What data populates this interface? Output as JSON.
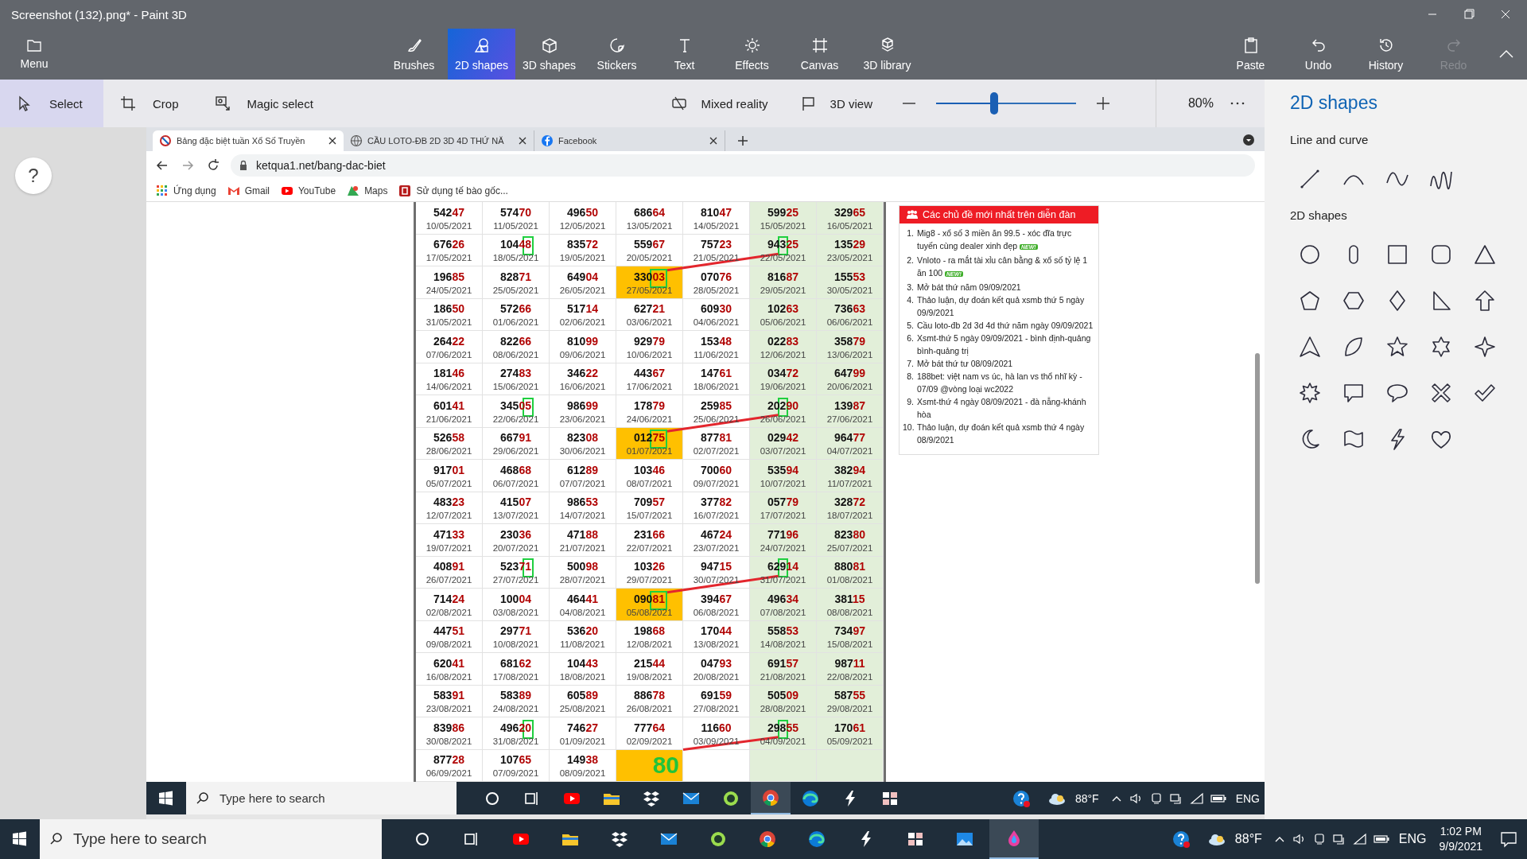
{
  "window": {
    "title": "Screenshot (132).png* - Paint 3D"
  },
  "menu": {
    "label": "Menu"
  },
  "tabs": [
    {
      "label": "Brushes",
      "selected": false
    },
    {
      "label": "2D shapes",
      "selected": true
    },
    {
      "label": "3D shapes",
      "selected": false
    },
    {
      "label": "Stickers",
      "selected": false
    },
    {
      "label": "Text",
      "selected": false
    },
    {
      "label": "Effects",
      "selected": false
    },
    {
      "label": "Canvas",
      "selected": false
    },
    {
      "label": "3D library",
      "selected": false
    }
  ],
  "actions": [
    {
      "label": "Paste",
      "disabled": false
    },
    {
      "label": "Undo",
      "disabled": false
    },
    {
      "label": "History",
      "disabled": false
    },
    {
      "label": "Redo",
      "disabled": true
    }
  ],
  "tools": [
    {
      "label": "Select",
      "selected": true
    },
    {
      "label": "Crop",
      "selected": false
    },
    {
      "label": "Magic select",
      "selected": false
    }
  ],
  "view_buttons": [
    {
      "label": "Mixed reality"
    },
    {
      "label": "3D view"
    }
  ],
  "zoom": {
    "level": 0.39,
    "reading": "80%"
  },
  "help": {
    "label": "?"
  },
  "panel": {
    "title": "2D shapes",
    "sections": [
      {
        "heading": "Line and curve",
        "kind": "lines"
      },
      {
        "heading": "2D shapes",
        "kind": "shapes"
      }
    ]
  },
  "browser": {
    "tabs": [
      {
        "title": "Bảng đặc biệt tuần Xổ Số Truyền",
        "selected": true
      },
      {
        "title": "CẦU LOTO-ĐB 2D 3D 4D THỨ NĂ",
        "selected": false
      },
      {
        "title": "Facebook",
        "selected": false
      }
    ],
    "address": "ketqua1.net/bang-dac-biet",
    "bookmarks": [
      {
        "label": "Ứng dụng"
      },
      {
        "label": "Gmail"
      },
      {
        "label": "YouTube"
      },
      {
        "label": "Maps"
      },
      {
        "label": "Sử dụng tế bào gốc..."
      }
    ]
  },
  "table": {
    "columns": [
      {
        "shaded": false
      },
      {
        "shaded": false
      },
      {
        "shaded": false
      },
      {
        "shaded": false
      },
      {
        "shaded": false
      },
      {
        "shaded": true
      },
      {
        "shaded": true
      }
    ],
    "rows": [
      [
        {
          "kind": "draw",
          "number": "54247",
          "date": "10/05/2021",
          "highlighted": false
        },
        {
          "kind": "draw",
          "number": "57470",
          "date": "11/05/2021",
          "highlighted": false
        },
        {
          "kind": "draw",
          "number": "49650",
          "date": "12/05/2021",
          "highlighted": false
        },
        {
          "kind": "draw",
          "number": "68664",
          "date": "13/05/2021",
          "highlighted": false
        },
        {
          "kind": "draw",
          "number": "81047",
          "date": "14/05/2021",
          "highlighted": false
        },
        {
          "kind": "draw",
          "number": "59925",
          "date": "15/05/2021",
          "highlighted": false
        },
        {
          "kind": "draw",
          "number": "32965",
          "date": "16/05/2021",
          "highlighted": false
        }
      ],
      [
        {
          "kind": "draw",
          "number": "67626",
          "date": "17/05/2021",
          "highlighted": false
        },
        {
          "kind": "draw",
          "number_segments": [
            {
              "text": "1044",
              "boxed": false
            },
            {
              "text": "8",
              "boxed": true
            }
          ],
          "date": "18/05/2021",
          "highlighted": false
        },
        {
          "kind": "draw",
          "number": "83572",
          "date": "19/05/2021",
          "highlighted": false
        },
        {
          "kind": "draw",
          "number": "55967",
          "date": "20/05/2021",
          "highlighted": false
        },
        {
          "kind": "draw",
          "number": "75723",
          "date": "21/05/2021",
          "highlighted": false
        },
        {
          "kind": "draw",
          "number_segments": [
            {
              "text": "94",
              "boxed": false
            },
            {
              "text": "3",
              "boxed": true
            },
            {
              "text": "25",
              "boxed": false
            }
          ],
          "date": "22/05/2021",
          "highlighted": false
        },
        {
          "kind": "draw",
          "number": "13529",
          "date": "23/05/2021",
          "highlighted": false
        }
      ],
      [
        {
          "kind": "draw",
          "number": "19685",
          "date": "24/05/2021",
          "highlighted": false
        },
        {
          "kind": "draw",
          "number": "82871",
          "date": "25/05/2021",
          "highlighted": false
        },
        {
          "kind": "draw",
          "number": "64904",
          "date": "26/05/2021",
          "highlighted": false
        },
        {
          "kind": "draw",
          "number_segments": [
            {
              "text": "330",
              "boxed": false
            },
            {
              "text": "03",
              "boxed": true
            }
          ],
          "date": "27/05/2021",
          "highlighted": true
        },
        {
          "kind": "draw",
          "number": "07076",
          "date": "28/05/2021",
          "highlighted": false
        },
        {
          "kind": "draw",
          "number": "81687",
          "date": "29/05/2021",
          "highlighted": false
        },
        {
          "kind": "draw",
          "number": "15553",
          "date": "30/05/2021",
          "highlighted": false
        }
      ],
      [
        {
          "kind": "draw",
          "number": "18650",
          "date": "31/05/2021",
          "highlighted": false
        },
        {
          "kind": "draw",
          "number": "57266",
          "date": "01/06/2021",
          "highlighted": false
        },
        {
          "kind": "draw",
          "number": "51714",
          "date": "02/06/2021",
          "highlighted": false
        },
        {
          "kind": "draw",
          "number": "62721",
          "date": "03/06/2021",
          "highlighted": false
        },
        {
          "kind": "draw",
          "number": "60930",
          "date": "04/06/2021",
          "highlighted": false
        },
        {
          "kind": "draw",
          "number": "10263",
          "date": "05/06/2021",
          "highlighted": false
        },
        {
          "kind": "draw",
          "number": "73663",
          "date": "06/06/2021",
          "highlighted": false
        }
      ],
      [
        {
          "kind": "draw",
          "number": "26422",
          "date": "07/06/2021",
          "highlighted": false
        },
        {
          "kind": "draw",
          "number": "82266",
          "date": "08/06/2021",
          "highlighted": false
        },
        {
          "kind": "draw",
          "number": "81099",
          "date": "09/06/2021",
          "highlighted": false
        },
        {
          "kind": "draw",
          "number": "92979",
          "date": "10/06/2021",
          "highlighted": false
        },
        {
          "kind": "draw",
          "number": "15348",
          "date": "11/06/2021",
          "highlighted": false
        },
        {
          "kind": "draw",
          "number": "02283",
          "date": "12/06/2021",
          "highlighted": false
        },
        {
          "kind": "draw",
          "number": "35879",
          "date": "13/06/2021",
          "highlighted": false
        }
      ],
      [
        {
          "kind": "draw",
          "number": "18146",
          "date": "14/06/2021",
          "highlighted": false
        },
        {
          "kind": "draw",
          "number": "27483",
          "date": "15/06/2021",
          "highlighted": false
        },
        {
          "kind": "draw",
          "number": "34622",
          "date": "16/06/2021",
          "highlighted": false
        },
        {
          "kind": "draw",
          "number": "44367",
          "date": "17/06/2021",
          "highlighted": false
        },
        {
          "kind": "draw",
          "number": "14761",
          "date": "18/06/2021",
          "highlighted": false
        },
        {
          "kind": "draw",
          "number": "03472",
          "date": "19/06/2021",
          "highlighted": false
        },
        {
          "kind": "draw",
          "number": "64799",
          "date": "20/06/2021",
          "highlighted": false
        }
      ],
      [
        {
          "kind": "draw",
          "number": "60141",
          "date": "21/06/2021",
          "highlighted": false
        },
        {
          "kind": "draw",
          "number_segments": [
            {
              "text": "3450",
              "boxed": false
            },
            {
              "text": "5",
              "boxed": true
            }
          ],
          "date": "22/06/2021",
          "highlighted": false
        },
        {
          "kind": "draw",
          "number": "98699",
          "date": "23/06/2021",
          "highlighted": false
        },
        {
          "kind": "draw",
          "number": "17879",
          "date": "24/06/2021",
          "highlighted": false
        },
        {
          "kind": "draw",
          "number": "25985",
          "date": "25/06/2021",
          "highlighted": false
        },
        {
          "kind": "draw",
          "number_segments": [
            {
              "text": "20",
              "boxed": false
            },
            {
              "text": "2",
              "boxed": true
            },
            {
              "text": "90",
              "boxed": false
            }
          ],
          "date": "26/06/2021",
          "highlighted": false
        },
        {
          "kind": "draw",
          "number": "13987",
          "date": "27/06/2021",
          "highlighted": false
        }
      ],
      [
        {
          "kind": "draw",
          "number": "52658",
          "date": "28/06/2021",
          "highlighted": false
        },
        {
          "kind": "draw",
          "number": "66791",
          "date": "29/06/2021",
          "highlighted": false
        },
        {
          "kind": "draw",
          "number": "82308",
          "date": "30/06/2021",
          "highlighted": false
        },
        {
          "kind": "draw",
          "number_segments": [
            {
              "text": "012",
              "boxed": false
            },
            {
              "text": "75",
              "boxed": true
            }
          ],
          "date": "01/07/2021",
          "highlighted": true
        },
        {
          "kind": "draw",
          "number": "87781",
          "date": "02/07/2021",
          "highlighted": false
        },
        {
          "kind": "draw",
          "number": "02942",
          "date": "03/07/2021",
          "highlighted": false
        },
        {
          "kind": "draw",
          "number": "96477",
          "date": "04/07/2021",
          "highlighted": false
        }
      ],
      [
        {
          "kind": "draw",
          "number": "91701",
          "date": "05/07/2021",
          "highlighted": false
        },
        {
          "kind": "draw",
          "number": "46868",
          "date": "06/07/2021",
          "highlighted": false
        },
        {
          "kind": "draw",
          "number": "61289",
          "date": "07/07/2021",
          "highlighted": false
        },
        {
          "kind": "draw",
          "number": "10346",
          "date": "08/07/2021",
          "highlighted": false
        },
        {
          "kind": "draw",
          "number": "70060",
          "date": "09/07/2021",
          "highlighted": false
        },
        {
          "kind": "draw",
          "number": "53594",
          "date": "10/07/2021",
          "highlighted": false
        },
        {
          "kind": "draw",
          "number": "38294",
          "date": "11/07/2021",
          "highlighted": false
        }
      ],
      [
        {
          "kind": "draw",
          "number": "48323",
          "date": "12/07/2021",
          "highlighted": false
        },
        {
          "kind": "draw",
          "number": "41507",
          "date": "13/07/2021",
          "highlighted": false
        },
        {
          "kind": "draw",
          "number": "98653",
          "date": "14/07/2021",
          "highlighted": false
        },
        {
          "kind": "draw",
          "number": "70957",
          "date": "15/07/2021",
          "highlighted": false
        },
        {
          "kind": "draw",
          "number": "37782",
          "date": "16/07/2021",
          "highlighted": false
        },
        {
          "kind": "draw",
          "number": "05779",
          "date": "17/07/2021",
          "highlighted": false
        },
        {
          "kind": "draw",
          "number": "32872",
          "date": "18/07/2021",
          "highlighted": false
        }
      ],
      [
        {
          "kind": "draw",
          "number": "47133",
          "date": "19/07/2021",
          "highlighted": false
        },
        {
          "kind": "draw",
          "number": "23036",
          "date": "20/07/2021",
          "highlighted": false
        },
        {
          "kind": "draw",
          "number": "47188",
          "date": "21/07/2021",
          "highlighted": false
        },
        {
          "kind": "draw",
          "number": "23166",
          "date": "22/07/2021",
          "highlighted": false
        },
        {
          "kind": "draw",
          "number": "46724",
          "date": "23/07/2021",
          "highlighted": false
        },
        {
          "kind": "draw",
          "number": "77196",
          "date": "24/07/2021",
          "highlighted": false
        },
        {
          "kind": "draw",
          "number": "82380",
          "date": "25/07/2021",
          "highlighted": false
        }
      ],
      [
        {
          "kind": "draw",
          "number": "40891",
          "date": "26/07/2021",
          "highlighted": false
        },
        {
          "kind": "draw",
          "number_segments": [
            {
              "text": "5237",
              "boxed": false
            },
            {
              "text": "1",
              "boxed": true
            }
          ],
          "date": "27/07/2021",
          "highlighted": false
        },
        {
          "kind": "draw",
          "number": "50098",
          "date": "28/07/2021",
          "highlighted": false
        },
        {
          "kind": "draw",
          "number": "10326",
          "date": "29/07/2021",
          "highlighted": false
        },
        {
          "kind": "draw",
          "number": "94715",
          "date": "30/07/2021",
          "highlighted": false
        },
        {
          "kind": "draw",
          "number_segments": [
            {
              "text": "62",
              "boxed": false
            },
            {
              "text": "9",
              "boxed": true
            },
            {
              "text": "14",
              "boxed": false
            }
          ],
          "date": "31/07/2021",
          "highlighted": false
        },
        {
          "kind": "draw",
          "number": "88081",
          "date": "01/08/2021",
          "highlighted": false
        }
      ],
      [
        {
          "kind": "draw",
          "number": "71424",
          "date": "02/08/2021",
          "highlighted": false
        },
        {
          "kind": "draw",
          "number": "10004",
          "date": "03/08/2021",
          "highlighted": false
        },
        {
          "kind": "draw",
          "number": "46441",
          "date": "04/08/2021",
          "highlighted": false
        },
        {
          "kind": "draw",
          "number_segments": [
            {
              "text": "090",
              "boxed": false
            },
            {
              "text": "81",
              "boxed": true
            }
          ],
          "date": "05/08/2021",
          "highlighted": true
        },
        {
          "kind": "draw",
          "number": "39467",
          "date": "06/08/2021",
          "highlighted": false
        },
        {
          "kind": "draw",
          "number": "49634",
          "date": "07/08/2021",
          "highlighted": false
        },
        {
          "kind": "draw",
          "number": "38115",
          "date": "08/08/2021",
          "highlighted": false
        }
      ],
      [
        {
          "kind": "draw",
          "number": "44751",
          "date": "09/08/2021",
          "highlighted": false
        },
        {
          "kind": "draw",
          "number": "29771",
          "date": "10/08/2021",
          "highlighted": false
        },
        {
          "kind": "draw",
          "number": "53620",
          "date": "11/08/2021",
          "highlighted": false
        },
        {
          "kind": "draw",
          "number": "19868",
          "date": "12/08/2021",
          "highlighted": false
        },
        {
          "kind": "draw",
          "number": "17044",
          "date": "13/08/2021",
          "highlighted": false
        },
        {
          "kind": "draw",
          "number": "55853",
          "date": "14/08/2021",
          "highlighted": false
        },
        {
          "kind": "draw",
          "number": "73497",
          "date": "15/08/2021",
          "highlighted": false
        }
      ],
      [
        {
          "kind": "draw",
          "number": "62041",
          "date": "16/08/2021",
          "highlighted": false
        },
        {
          "kind": "draw",
          "number": "68162",
          "date": "17/08/2021",
          "highlighted": false
        },
        {
          "kind": "draw",
          "number": "10443",
          "date": "18/08/2021",
          "highlighted": false
        },
        {
          "kind": "draw",
          "number": "21544",
          "date": "19/08/2021",
          "highlighted": false
        },
        {
          "kind": "draw",
          "number": "04793",
          "date": "20/08/2021",
          "highlighted": false
        },
        {
          "kind": "draw",
          "number": "69157",
          "date": "21/08/2021",
          "highlighted": false
        },
        {
          "kind": "draw",
          "number": "98711",
          "date": "22/08/2021",
          "highlighted": false
        }
      ],
      [
        {
          "kind": "draw",
          "number": "58391",
          "date": "23/08/2021",
          "highlighted": false
        },
        {
          "kind": "draw",
          "number": "58389",
          "date": "24/08/2021",
          "highlighted": false
        },
        {
          "kind": "draw",
          "number": "60589",
          "date": "25/08/2021",
          "highlighted": false
        },
        {
          "kind": "draw",
          "number": "88678",
          "date": "26/08/2021",
          "highlighted": false
        },
        {
          "kind": "draw",
          "number": "69159",
          "date": "27/08/2021",
          "highlighted": false
        },
        {
          "kind": "draw",
          "number": "50509",
          "date": "28/08/2021",
          "highlighted": false
        },
        {
          "kind": "draw",
          "number": "58755",
          "date": "29/08/2021",
          "highlighted": false
        }
      ],
      [
        {
          "kind": "draw",
          "number": "83986",
          "date": "30/08/2021",
          "highlighted": false
        },
        {
          "kind": "draw",
          "number_segments": [
            {
              "text": "4962",
              "boxed": false
            },
            {
              "text": "0",
              "boxed": true
            }
          ],
          "date": "31/08/2021",
          "highlighted": false
        },
        {
          "kind": "draw",
          "number": "74627",
          "date": "01/09/2021",
          "highlighted": false
        },
        {
          "kind": "draw",
          "number": "77764",
          "date": "02/09/2021",
          "highlighted": false
        },
        {
          "kind": "draw",
          "number": "11660",
          "date": "03/09/2021",
          "highlighted": false
        },
        {
          "kind": "draw",
          "number_segments": [
            {
              "text": "29",
              "boxed": false
            },
            {
              "text": "8",
              "boxed": true
            },
            {
              "text": "55",
              "boxed": false
            }
          ],
          "date": "04/09/2021",
          "highlighted": false
        },
        {
          "kind": "draw",
          "number": "17061",
          "date": "05/09/2021",
          "highlighted": false
        }
      ],
      [
        {
          "kind": "draw",
          "number": "87728",
          "date": "06/09/2021",
          "highlighted": false
        },
        {
          "kind": "draw",
          "number": "10765",
          "date": "07/09/2021",
          "highlighted": false
        },
        {
          "kind": "draw",
          "number": "14938",
          "date": "08/09/2021",
          "highlighted": false
        },
        {
          "kind": "result",
          "value": "80",
          "highlighted": true
        },
        {
          "kind": "empty",
          "highlighted": false
        },
        {
          "kind": "empty",
          "highlighted": false
        },
        {
          "kind": "empty",
          "highlighted": false
        }
      ]
    ]
  },
  "forum": {
    "title": "Các chủ đề mới nhất trên diễn đàn",
    "items": [
      {
        "number": "1.",
        "text": "Mig8 - xổ số 3 miền ăn 99.5 - xóc đĩa trực tuyến cùng dealer xinh đẹp",
        "badge": "NEW!"
      },
      {
        "number": "2.",
        "text": "Vnloto - ra mắt tài xỉu cân bằng & xổ số tỷ lệ 1 ăn 100",
        "badge": "NEW!"
      },
      {
        "number": "3.",
        "text": "Mở bát thứ năm 09/09/2021"
      },
      {
        "number": "4.",
        "text": "Thảo luận, dự đoán kết quả xsmb thứ 5 ngày 09/9/2021"
      },
      {
        "number": "5.",
        "text": "Cầu loto-đb 2d 3d 4d thứ năm ngày 09/09/2021"
      },
      {
        "number": "6.",
        "text": "Xsmt-thứ 5 ngày 09/09/2021 - bình định-quảng bình-quảng trị"
      },
      {
        "number": "7.",
        "text": "Mở bát thứ tư 08/09/2021"
      },
      {
        "number": "8.",
        "text": "188bet: việt nam vs úc, hà lan vs thổ nhĩ kỳ - 07/09 @vòng loại wc2022"
      },
      {
        "number": "9.",
        "text": "Xsmt-thứ 4 ngày 08/09/2021 - đà nẵng-khánh hòa"
      },
      {
        "number": "10.",
        "text": "Thảo luận, dự đoán kết quả xsmb thứ 4 ngày 08/9/2021"
      }
    ]
  },
  "embedded_taskbar": {
    "search": {
      "placeholder": "Type here to search"
    },
    "weather": "88°F",
    "language": "ENG"
  },
  "taskbar": {
    "search": {
      "placeholder": "Type here to search"
    },
    "weather": "88°F",
    "language": "ENG",
    "time": "1:02 PM",
    "date": "9/9/2021"
  }
}
